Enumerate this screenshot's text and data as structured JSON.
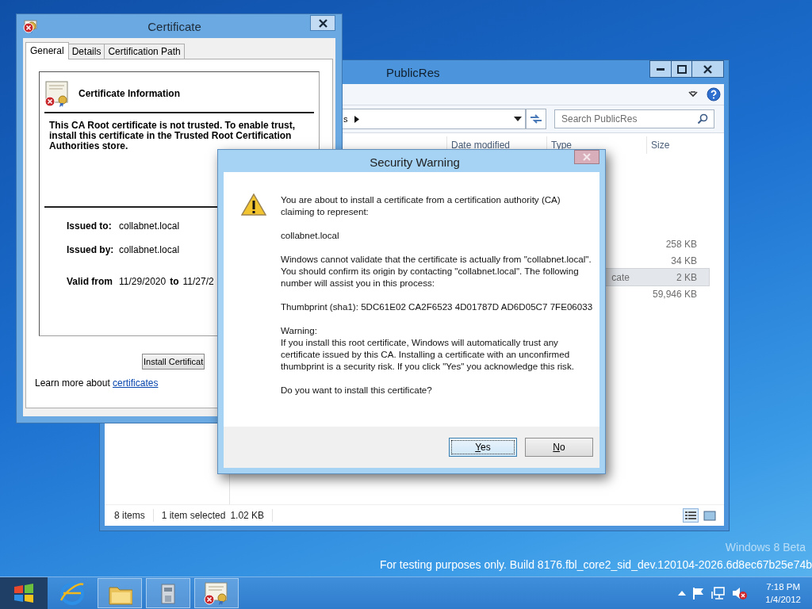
{
  "certificate_window": {
    "title": "Certificate",
    "tabs": [
      {
        "label": "General",
        "selected": true
      },
      {
        "label": "Details",
        "selected": false
      },
      {
        "label": "Certification Path",
        "selected": false
      }
    ],
    "heading": "Certificate Information",
    "message": "This CA Root certificate is not trusted. To enable trust, install this certificate in the Trusted Root Certification Authorities store.",
    "fields": [
      {
        "label": "Issued to:",
        "value": "collabnet.local"
      },
      {
        "label": "Issued by:",
        "value": "collabnet.local"
      }
    ],
    "validity": {
      "label": "Valid from",
      "from": "11/29/2020",
      "to_label": "to",
      "to": "11/27/2"
    },
    "install_button": "Install Certificat",
    "learn_more": {
      "text": "Learn more about",
      "link": "certificates"
    }
  },
  "explorer_window": {
    "title": "PublicRes",
    "address_fragment": "s",
    "search": {
      "placeholder": "Search PublicRes"
    },
    "columns": [
      "Date modified",
      "Type",
      "Size"
    ],
    "rows": [
      {
        "size": "258 KB",
        "selected": false
      },
      {
        "size": "34 KB",
        "selected": false
      },
      {
        "type": "cate",
        "size": "2 KB",
        "selected": true
      },
      {
        "size": "59,946 KB",
        "selected": false
      }
    ],
    "status": {
      "item_count": "8 items",
      "selection": "1 item selected",
      "selection_size": "1.02 KB"
    },
    "views": [
      {
        "kind": "details",
        "selected": true
      },
      {
        "kind": "large-icons",
        "selected": false
      }
    ]
  },
  "security_warning": {
    "title": "Security Warning",
    "paragraphs": [
      "You are about to install a certificate from a certification authority (CA) claiming to represent:",
      "collabnet.local",
      "Windows cannot validate that the certificate is actually from \"collabnet.local\". You should confirm its origin by contacting \"collabnet.local\". The following number will assist you in this process:",
      "Thumbprint (sha1): 5DC61E02 CA2F6523 4D01787D AD6D05C7 7FE06033",
      "Warning:\nIf you install this root certificate, Windows will automatically trust any certificate issued by this CA. Installing a certificate with an unconfirmed thumbprint is a security risk. If you click \"Yes\" you acknowledge this risk.",
      "Do you want to install this certificate?"
    ],
    "buttons": [
      {
        "label": "Yes",
        "default": true
      },
      {
        "label": "No",
        "default": false
      }
    ]
  },
  "desktop": {
    "edition": "Windows 8 Beta",
    "build": "For testing purposes only. Build 8176.fbl_core2_sid_dev.120104-2026.6d8ec67b25e74b"
  },
  "taskbar": {
    "apps": [
      {
        "kind": "browser",
        "open": false
      },
      {
        "kind": "folder",
        "open": true
      },
      {
        "kind": "control-panel",
        "open": true
      },
      {
        "kind": "certificate",
        "open": true
      }
    ],
    "clock": {
      "time": "7:18 PM",
      "date": "1/4/2012"
    }
  }
}
